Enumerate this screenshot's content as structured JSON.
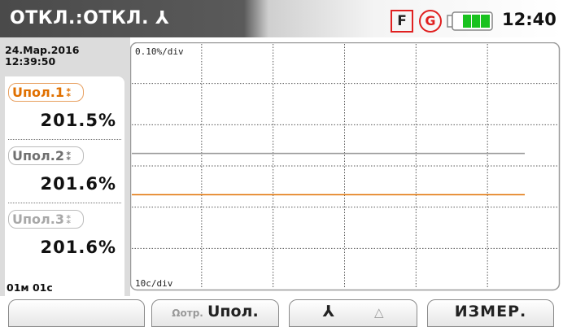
{
  "header": {
    "title": "ОТКЛ.:ОТКЛ. ⅄",
    "flag_f": "F",
    "flag_g": "G",
    "time": "12:40"
  },
  "left_panel": {
    "date": "24.Мар.2016",
    "time": "12:39:50",
    "elapsed": "01м 01с",
    "channels": [
      {
        "label": "Uпол.1",
        "symbol": "⁑",
        "value": "201.5%",
        "color": "#e07000"
      },
      {
        "label": "Uпол.2",
        "symbol": "⁑",
        "value": "201.6%",
        "color": "#707070"
      },
      {
        "label": "Uпол.3",
        "symbol": "⁑",
        "value": "201.6%",
        "color": "#a8a8a8"
      }
    ]
  },
  "chart_data": {
    "type": "line",
    "y_scale_label": "0.10%/div",
    "x_scale_label": "10с/div",
    "grid": true,
    "series": [
      {
        "name": "Uпол.1",
        "color": "#e07000",
        "value": 201.5
      },
      {
        "name": "Uпол.2",
        "color": "#9a9a9a",
        "value": 201.6
      },
      {
        "name": "Uпол.3",
        "color": "#c8c8c8",
        "value": 201.6
      }
    ]
  },
  "function_keys": {
    "f1": "",
    "f2_sub": "Ωотр.",
    "f2_main": "Uпол.",
    "f3_main": "⅄",
    "f3_alt": "△",
    "f4_main": "ИЗМЕР."
  },
  "colors": {
    "accent": "#e07000",
    "flag_red": "#e02020",
    "battery_green": "#19c21f"
  }
}
